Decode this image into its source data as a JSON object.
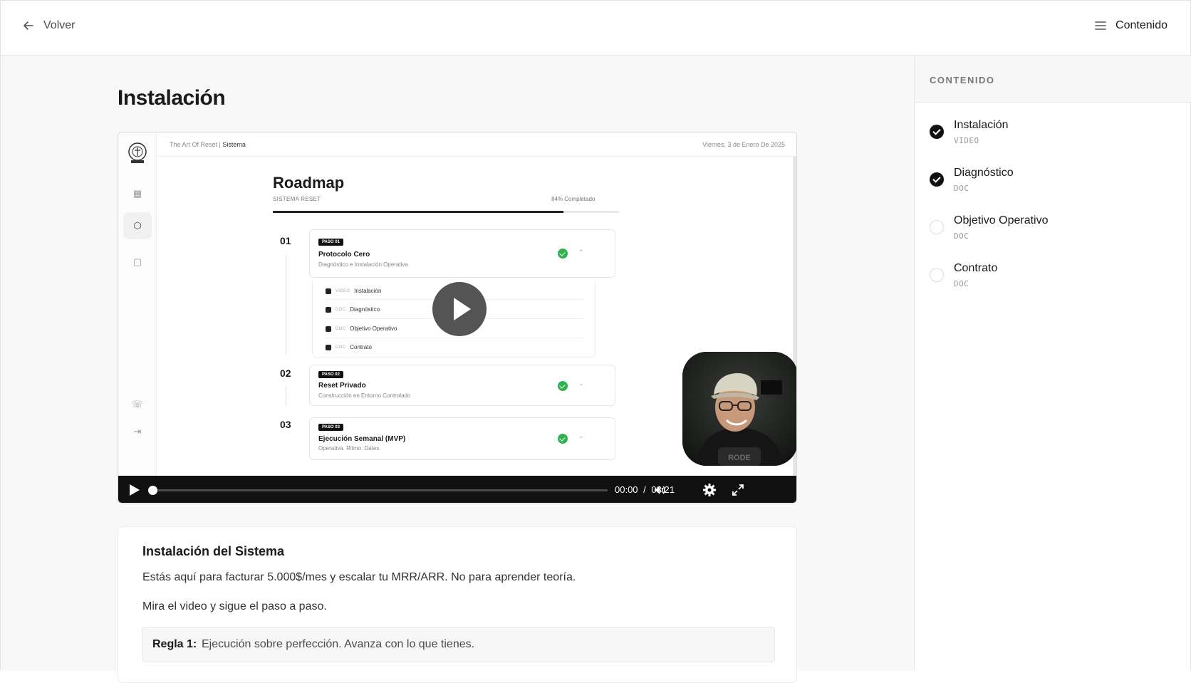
{
  "topbar": {
    "back_label": "Volver",
    "contents_label": "Contenido"
  },
  "lesson": {
    "title": "Instalación"
  },
  "video": {
    "current_time": "00:00",
    "separator": "/",
    "duration": "03:21",
    "progress": 0.0,
    "screen": {
      "breadcrumb_root": "The Art Of Reset",
      "breadcrumb_current": "Sistema",
      "date": "Viernes, 3 de Enero De 2025",
      "title": "Roadmap",
      "subtitle": "SISTEMA RESET",
      "progress_label": "84% Completado",
      "progress_value": 0.84,
      "steps": [
        {
          "num": "01",
          "tag": "PASO 01",
          "title": "Protocolo Cero",
          "desc": "Diagnóstico e Instalación Operativa",
          "chevron": "⌃"
        },
        {
          "num": "02",
          "tag": "PASO 02",
          "title": "Reset Privado",
          "desc": "Construcción en Entorno Controlado",
          "chevron": "⌄"
        },
        {
          "num": "03",
          "tag": "PASO 03",
          "title": "Ejecución Semanal (MVP)",
          "desc": "Operativa. Ritmo. Dates.",
          "chevron": "⌄"
        }
      ],
      "items": [
        {
          "kind": "VIDEO",
          "label": "Instalación"
        },
        {
          "kind": "DOC",
          "label": "Diagnóstico"
        },
        {
          "kind": "DOC",
          "label": "Objetivo Operativo"
        },
        {
          "kind": "DOC",
          "label": "Contrato"
        }
      ]
    }
  },
  "description": {
    "title": "Instalación del Sistema",
    "paragraph1": "Estás aquí para facturar 5.000$/mes y escalar tu MRR/ARR. No para aprender teoría.",
    "paragraph2": "Mira el video y sigue el paso a paso.",
    "rule_label": "Regla 1:",
    "rule_text": "Ejecución sobre perfección. Avanza con lo que tienes."
  },
  "sidebar": {
    "heading": "CONTENIDO",
    "items": [
      {
        "label": "Instalación",
        "type": "VIDEO",
        "completed": true
      },
      {
        "label": "Diagnóstico",
        "type": "DOC",
        "completed": true
      },
      {
        "label": "Objetivo Operativo",
        "type": "DOC",
        "completed": false
      },
      {
        "label": "Contrato",
        "type": "DOC",
        "completed": false
      }
    ]
  },
  "colors": {
    "accent_dark": "#111111",
    "success": "#2fb34c",
    "background": "#f8f8f8"
  }
}
